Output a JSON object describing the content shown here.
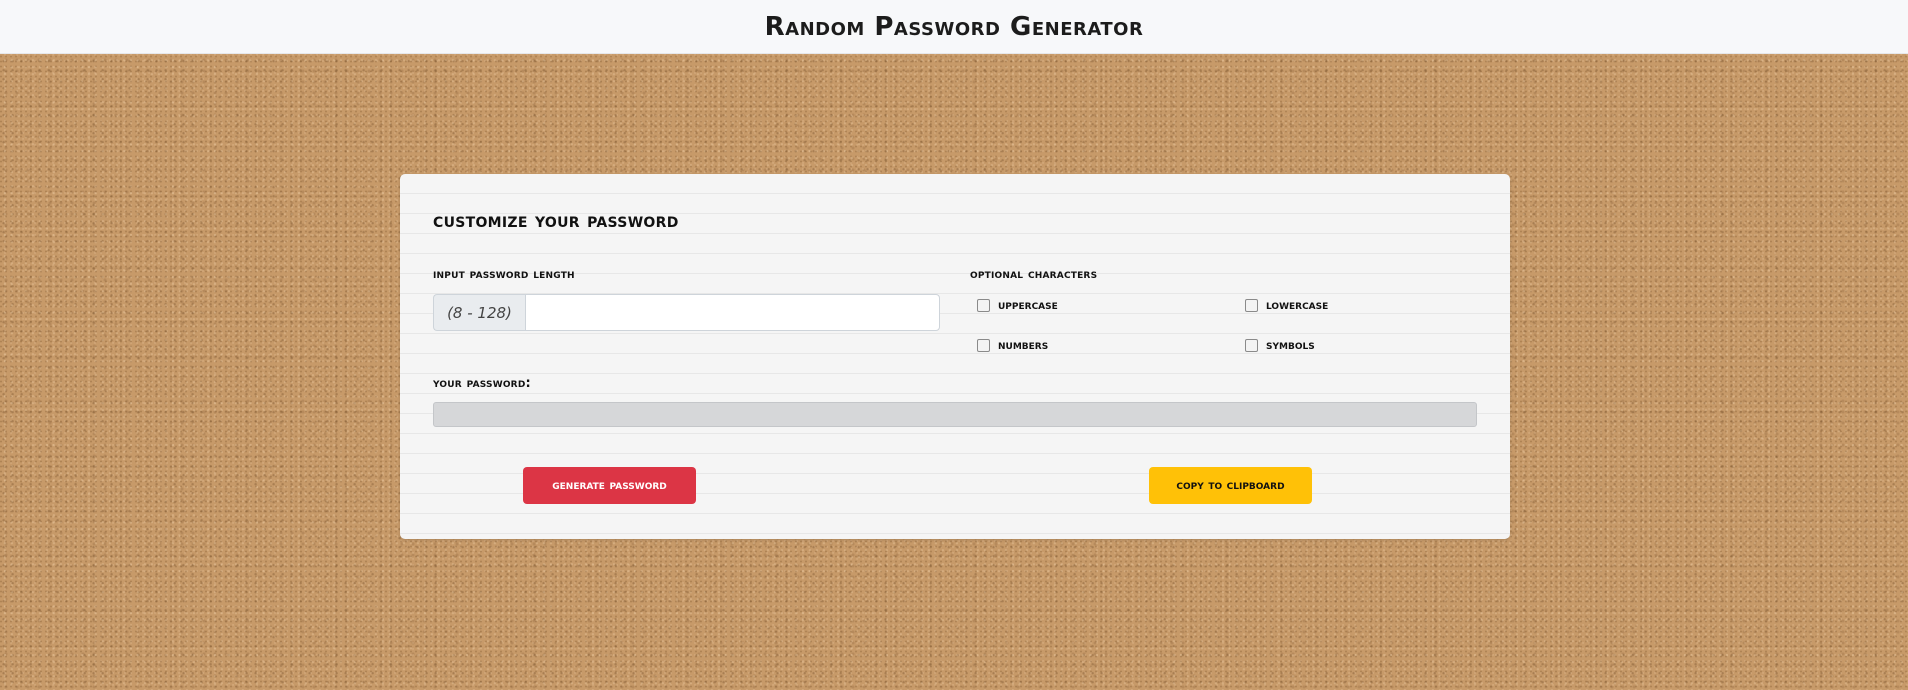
{
  "header": {
    "title": "Random Password Generator"
  },
  "card": {
    "title": "customize your password",
    "length_label": "input password length",
    "length_addon": "(8 - 128)",
    "length_value": "",
    "optional_label": "optional characters",
    "options": {
      "uppercase": {
        "label": "uppercase",
        "checked": false
      },
      "lowercase": {
        "label": "lowercase",
        "checked": false
      },
      "numbers": {
        "label": "numbers",
        "checked": false
      },
      "symbols": {
        "label": "symbols",
        "checked": false
      }
    },
    "password_label": "your password:",
    "password_value": "",
    "generate_label": "generate password",
    "copy_label": "copy to clipboard"
  },
  "colors": {
    "generate_button": "#dc3545",
    "copy_button": "#ffc107",
    "background": "#c79a69"
  }
}
